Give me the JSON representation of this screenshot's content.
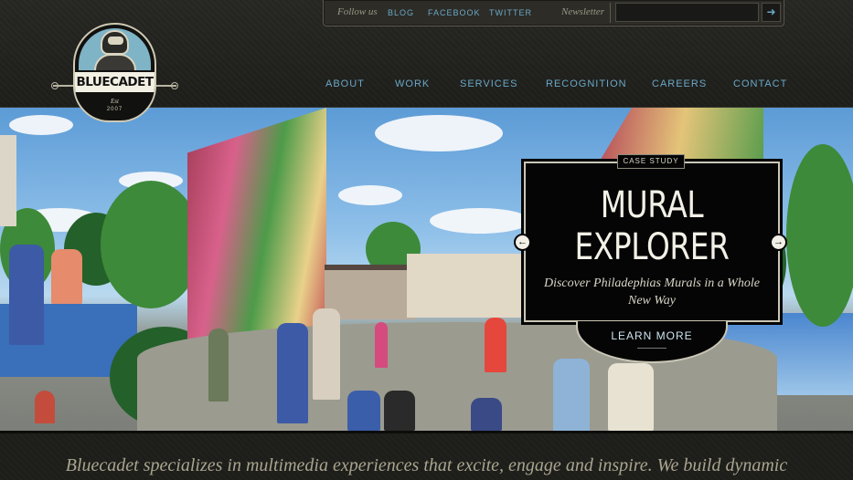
{
  "topbar": {
    "follow_label": "Follow us",
    "social": [
      "BLOG",
      "FACEBOOK",
      "TWITTER"
    ],
    "newsletter_label": "Newsletter",
    "newsletter_placeholder": "",
    "submit_icon": "arrow-right-icon"
  },
  "logo": {
    "name": "BLUECADET",
    "est": "Est",
    "year": "2007"
  },
  "nav": {
    "items": [
      "ABOUT",
      "WORK",
      "SERVICES",
      "RECOGNITION",
      "CAREERS",
      "CONTACT"
    ]
  },
  "hero": {
    "tag": "CASE STUDY",
    "title_line1": "MURAL",
    "title_line2": "EXPLORER",
    "subtitle": "Discover Philadephias Murals in a Whole New Way",
    "cta": "LEARN MORE",
    "prev_icon": "arrow-left-icon",
    "next_icon": "arrow-right-icon"
  },
  "intro": {
    "text": "Bluecadet specializes in multimedia experiences that excite, engage and inspire. We build dynamic"
  },
  "colors": {
    "link_blue": "#6aa8c6",
    "header_bg": "#1d1d1a",
    "card_bg": "#050505",
    "cream": "#f3f1e7"
  }
}
